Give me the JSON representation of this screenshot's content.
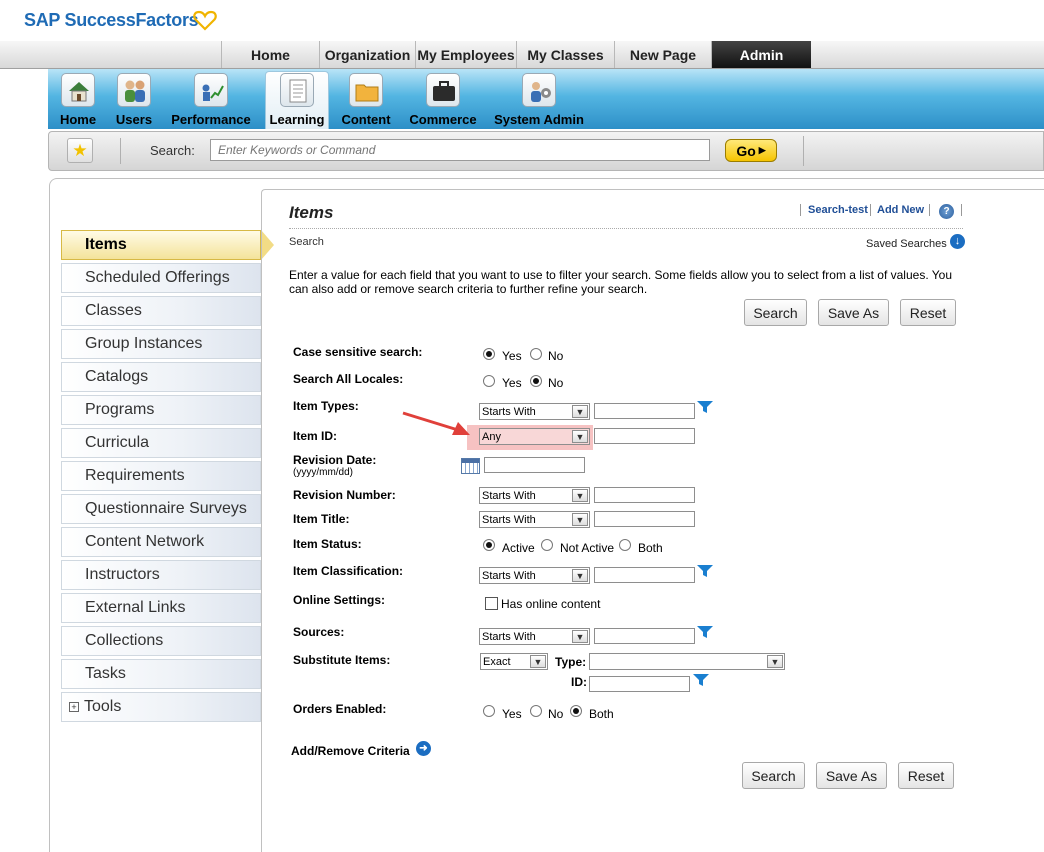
{
  "brand": {
    "name": "SAP SuccessFactors"
  },
  "top_nav": {
    "tabs": [
      {
        "label": "Home"
      },
      {
        "label": "Organization"
      },
      {
        "label": "My Employees"
      },
      {
        "label": "My Classes"
      },
      {
        "label": "New Page"
      },
      {
        "label": "Admin",
        "active": true
      }
    ]
  },
  "modules": [
    {
      "label": "Home",
      "icon": "house-icon"
    },
    {
      "label": "Users",
      "icon": "users-icon"
    },
    {
      "label": "Performance",
      "icon": "performance-chart-icon"
    },
    {
      "label": "Learning",
      "icon": "document-icon",
      "active": true
    },
    {
      "label": "Content",
      "icon": "folder-icon"
    },
    {
      "label": "Commerce",
      "icon": "briefcase-icon"
    },
    {
      "label": "System Admin",
      "icon": "admin-gear-icon"
    }
  ],
  "search_bar": {
    "label": "Search:",
    "placeholder": "Enter Keywords or Command",
    "go_label": "Go"
  },
  "sidebar": {
    "items": [
      {
        "label": "Items",
        "active": true
      },
      {
        "label": "Scheduled Offerings"
      },
      {
        "label": "Classes"
      },
      {
        "label": "Group Instances"
      },
      {
        "label": "Catalogs"
      },
      {
        "label": "Programs"
      },
      {
        "label": "Curricula"
      },
      {
        "label": "Requirements"
      },
      {
        "label": "Questionnaire Surveys"
      },
      {
        "label": "Content Network"
      },
      {
        "label": "Instructors"
      },
      {
        "label": "External Links"
      },
      {
        "label": "Collections"
      },
      {
        "label": "Tasks"
      },
      {
        "label": "Tools"
      }
    ]
  },
  "page": {
    "title": "Items",
    "subtitle": "Search",
    "links": {
      "search_test": "Search-test",
      "add_new": "Add New"
    },
    "help_symbol": "?",
    "saved_searches": "Saved Searches",
    "instructions": "Enter a value for each field that you want to use to filter your search. Some fields allow you to select from a list of values. You can also add or remove search criteria to further refine your search."
  },
  "buttons": {
    "search": "Search",
    "save_as": "Save As",
    "reset": "Reset"
  },
  "form": {
    "case_sensitive": {
      "label": "Case sensitive search:",
      "options": [
        "Yes",
        "No"
      ],
      "selected": "Yes"
    },
    "all_locales": {
      "label": "Search All Locales:",
      "options": [
        "Yes",
        "No"
      ],
      "selected": "No"
    },
    "item_types": {
      "label": "Item Types:",
      "operator": "Starts With",
      "value": ""
    },
    "item_id": {
      "label": "Item ID:",
      "operator": "Any",
      "value": ""
    },
    "revision_date": {
      "label": "Revision Date:",
      "hint": "(yyyy/mm/dd)",
      "value": ""
    },
    "revision_number": {
      "label": "Revision Number:",
      "operator": "Starts With",
      "value": ""
    },
    "item_title": {
      "label": "Item Title:",
      "operator": "Starts With",
      "value": ""
    },
    "item_status": {
      "label": "Item Status:",
      "options": [
        "Active",
        "Not Active",
        "Both"
      ],
      "selected": "Active"
    },
    "item_classification": {
      "label": "Item Classification:",
      "operator": "Starts With",
      "value": ""
    },
    "online_settings": {
      "label": "Online Settings:",
      "checkbox_label": "Has online content",
      "checked": false
    },
    "sources": {
      "label": "Sources:",
      "operator": "Starts With",
      "value": ""
    },
    "substitute_items": {
      "label": "Substitute Items:",
      "operator": "Exact",
      "type_label": "Type:",
      "type_value": "",
      "id_label": "ID:",
      "id_value": ""
    },
    "orders_enabled": {
      "label": "Orders Enabled:",
      "options": [
        "Yes",
        "No",
        "Both"
      ],
      "selected": "Both"
    },
    "add_remove": "Add/Remove Criteria"
  },
  "colors": {
    "brand_blue": "#1f6bb5",
    "heart": "#f0b400",
    "highlight": "#f6c2c2",
    "arrow": "#e0403a",
    "link": "#1f4e96"
  }
}
